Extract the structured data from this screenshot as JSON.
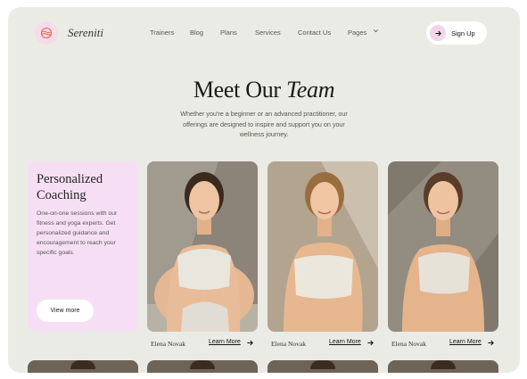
{
  "brand": {
    "name": "Sereniti",
    "logo_icon": "wave-icon"
  },
  "nav": {
    "items": [
      "Trainers",
      "Blog",
      "Plans",
      "Services",
      "Contact Us",
      "Pages"
    ],
    "signup_label": "Sign Up"
  },
  "hero": {
    "title_plain": "Meet Our",
    "title_italic": "Team",
    "subtitle": "Whether you're a beginner or an advanced practitioner, our offerings are designed to inspire and support you on your wellness journey."
  },
  "feature_card": {
    "title": "Personalized Coaching",
    "description": "One-on-one sessions with our fitness and yoga experts. Get personalized guidance and encouragement to reach your specific goals.",
    "button_label": "View more",
    "color": "#f6dff5"
  },
  "team": [
    {
      "name": "Elena Novak",
      "link_label": "Learn More"
    },
    {
      "name": "Elena Novak",
      "link_label": "Learn More"
    },
    {
      "name": "Elena Novak",
      "link_label": "Learn More"
    }
  ],
  "colors": {
    "background": "#ebebe5",
    "accent_pink": "#f3d4e8",
    "text": "#1a1a1a"
  }
}
